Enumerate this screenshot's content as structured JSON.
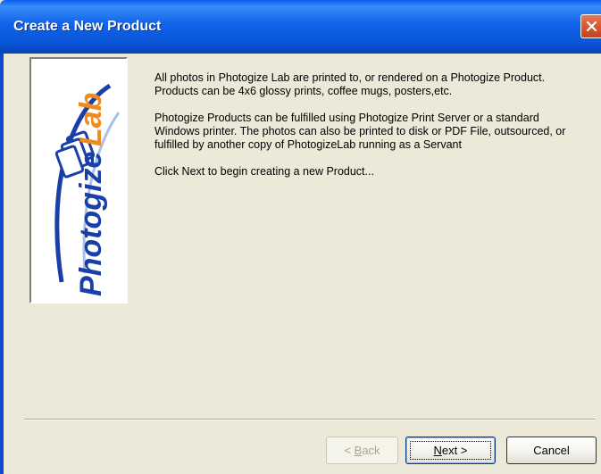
{
  "window": {
    "title": "Create a New Product"
  },
  "logo": {
    "text_photogize": "Photogize",
    "text_lab": "Lab",
    "brand_blue": "#1a3fa8",
    "brand_orange": "#f08a1c"
  },
  "intro": {
    "paragraph1": "All photos in Photogize Lab are printed to, or rendered on a Photogize Product.  Products can be 4x6 glossy prints, coffee mugs, posters,etc.",
    "paragraph2": "Photogize Products can be fulfilled using Photogize Print Server or a standard Windows printer. The photos can also be printed to disk or PDF File, outsourced, or fulfilled by another copy of PhotogizeLab running as a Servant",
    "paragraph3": "Click Next to begin creating a new Product..."
  },
  "buttons": {
    "back_prefix": "< ",
    "back_mnemonic": "B",
    "back_rest": "ack",
    "back_enabled": false,
    "next_mnemonic": "N",
    "next_rest": "ext >",
    "cancel_label": "Cancel"
  }
}
